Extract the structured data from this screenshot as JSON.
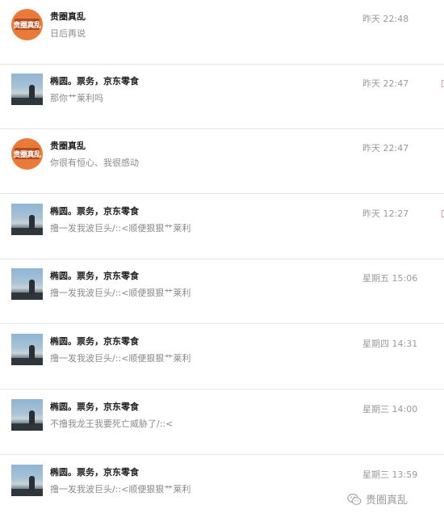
{
  "conversations": [
    {
      "title": "贵圈真乱",
      "preview": "日后再说",
      "time": "昨天 22:48",
      "avatar": "logo"
    },
    {
      "title": "椭圆。票务，京东零食",
      "preview": "那你艹莱利吗",
      "time": "昨天 22:47",
      "avatar": "photo"
    },
    {
      "title": "贵圈真乱",
      "preview": "你很有恒心、我很感动",
      "time": "昨天 22:47",
      "avatar": "logo"
    },
    {
      "title": "椭圆。票务，京东零食",
      "preview": "撸一发我波巨头/::<顺便狠狠艹莱利",
      "time": "昨天 12:27",
      "avatar": "photo"
    },
    {
      "title": "椭圆。票务，京东零食",
      "preview": "撸一发我波巨头/::<顺便狠狠艹莱利",
      "time": "星期五 15:06",
      "avatar": "photo"
    },
    {
      "title": "椭圆。票务，京东零食",
      "preview": "撸一发我波巨头/::<顺便狠狠艹莱利",
      "time": "星期四 14:31",
      "avatar": "photo"
    },
    {
      "title": "椭圆。票务，京东零食",
      "preview": "不撸我龙王我要死亡威胁了/::<",
      "time": "星期三 14:00",
      "avatar": "photo"
    },
    {
      "title": "椭圆。票务，京东零食",
      "preview": "撸一发我波巨头/::<顺便狠狠艹莱利",
      "time": "星期三 13:59",
      "avatar": "photo"
    }
  ],
  "logo_text": "贵圈真乱",
  "watermark": {
    "text": "贵圈真乱",
    "icon": "wechat-icon"
  },
  "colors": {
    "logo_orange": "#e97a3a",
    "title": "#1f1f1f",
    "preview": "#8a8a8a",
    "time": "#9a9a9a",
    "separator": "#e6e6e6"
  }
}
